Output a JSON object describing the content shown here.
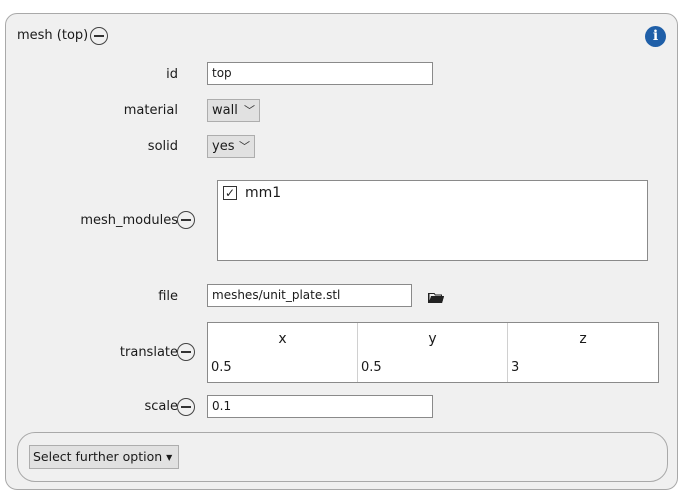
{
  "panel": {
    "title": "mesh (top)",
    "collapse_icon": "minus-circle-icon",
    "info_icon": "info-icon",
    "info_glyph": "i"
  },
  "fields": {
    "id": {
      "label": "id",
      "value": "top"
    },
    "material": {
      "label": "material",
      "value": "wall",
      "chevron": "﹀"
    },
    "solid": {
      "label": "solid",
      "value": "yes",
      "chevron": "﹀"
    },
    "mesh_modules": {
      "label": "mesh_modules",
      "items": [
        {
          "label": "mm1",
          "checked": true,
          "check_glyph": "✓"
        }
      ]
    },
    "file": {
      "label": "file",
      "value": "meshes/unit_plate.stl",
      "icon": "folder-icon"
    },
    "translate": {
      "label": "translate",
      "columns": [
        "x",
        "y",
        "z"
      ],
      "values": [
        "0.5",
        "0.5",
        "3"
      ]
    },
    "scale": {
      "label": "scale",
      "value": "0.1"
    }
  },
  "further_option": {
    "label": "Select further option",
    "caret": "▼"
  }
}
